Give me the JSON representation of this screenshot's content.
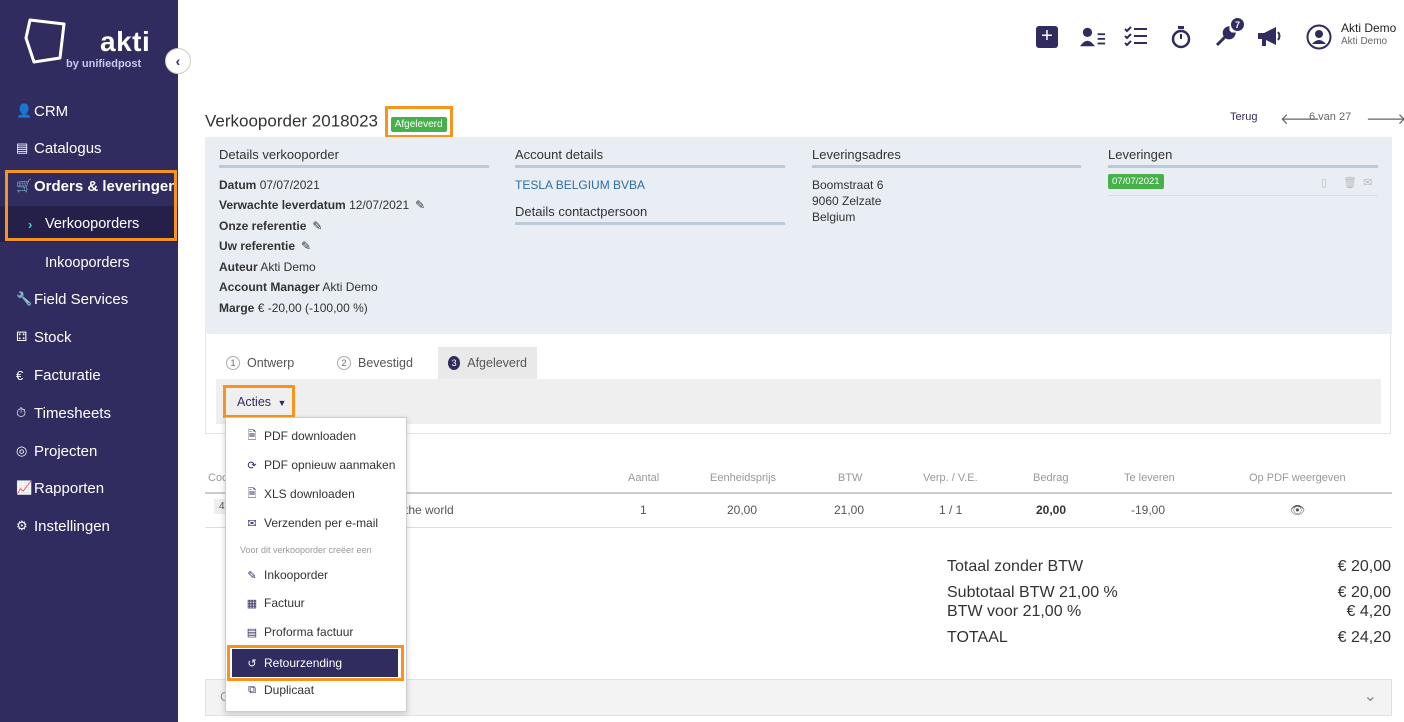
{
  "brand": {
    "name": "akti",
    "tagline": "by unifiedpost"
  },
  "sidebar": {
    "items": [
      {
        "label": "CRM",
        "icon": "user-icon"
      },
      {
        "label": "Catalogus",
        "icon": "book-icon"
      },
      {
        "label": "Orders & leveringen",
        "icon": "cart-icon"
      },
      {
        "label": "Verkooporders",
        "icon": "chevron-right-icon"
      },
      {
        "label": "Inkooporders"
      },
      {
        "label": "Field Services",
        "icon": "wrench-icon"
      },
      {
        "label": "Stock",
        "icon": "cubes-icon"
      },
      {
        "label": "Facturatie",
        "icon": "euro-icon"
      },
      {
        "label": "Timesheets",
        "icon": "stopwatch-icon"
      },
      {
        "label": "Projecten",
        "icon": "target-icon"
      },
      {
        "label": "Rapporten",
        "icon": "chart-icon"
      },
      {
        "label": "Instellingen",
        "icon": "gear-icon"
      }
    ]
  },
  "topbar": {
    "badge_count": "7",
    "user_name": "Akti Demo",
    "user_sub": "Akti Demo"
  },
  "header": {
    "title": "Verkooporder 2018023",
    "status": "Afgeleverd",
    "back": "Terug",
    "pager": "6 van 27"
  },
  "details": {
    "title": "Details verkooporder",
    "rows": [
      {
        "label": "Datum",
        "value": "07/07/2021"
      },
      {
        "label": "Verwachte leverdatum",
        "value": "12/07/2021"
      },
      {
        "label": "Onze referentie",
        "value": ""
      },
      {
        "label": "Uw referentie",
        "value": ""
      },
      {
        "label": "Auteur",
        "value": "Akti Demo"
      },
      {
        "label": "Account Manager",
        "value": "Akti Demo"
      },
      {
        "label": "Marge",
        "value": "€ -20,00 (-100,00 %)"
      }
    ]
  },
  "account": {
    "title": "Account details",
    "company": "TESLA BELGIUM BVBA",
    "contact_title": "Details contactpersoon"
  },
  "delivery_address": {
    "title": "Leveringsadres",
    "line1": "Boomstraat 6",
    "line2": "9060 Zelzate",
    "line3": "Belgium"
  },
  "deliveries": {
    "title": "Leveringen",
    "date": "07/07/2021"
  },
  "tabs": [
    {
      "num": "1",
      "label": "Ontwerp"
    },
    {
      "num": "2",
      "label": "Bevestigd"
    },
    {
      "num": "3",
      "label": "Afgeleverd"
    }
  ],
  "actions": {
    "button": "Acties",
    "menu": [
      {
        "label": "PDF downloaden",
        "icon": "pdf-icon"
      },
      {
        "label": "PDF opnieuw aanmaken",
        "icon": "refresh-icon"
      },
      {
        "label": "XLS downloaden",
        "icon": "xls-icon"
      },
      {
        "label": "Verzenden per e-mail",
        "icon": "envelope-icon"
      }
    ],
    "section_label": "Voor dit verkooporder creëer een",
    "create_menu": [
      {
        "label": "Inkooporder",
        "icon": "pen-icon"
      },
      {
        "label": "Factuur",
        "icon": "invoice-icon"
      },
      {
        "label": "Proforma factuur",
        "icon": "proforma-icon"
      },
      {
        "label": "Retourzending",
        "icon": "undo-icon"
      },
      {
        "label": "Duplicaat",
        "icon": "copy-icon"
      }
    ]
  },
  "table": {
    "headers": {
      "code": "Coc",
      "aantal": "Aantal",
      "eenheidsprijs": "Eenheidsprijs",
      "btw": "BTW",
      "verp": "Verp. / V.E.",
      "bedrag": "Bedrag",
      "te_leveren": "Te leveren",
      "op_pdf": "Op PDF weergeven"
    },
    "row": {
      "code": "4",
      "description": "the world",
      "aantal": "1",
      "eenheidsprijs": "20,00",
      "btw": "21,00",
      "verp": "1 / 1",
      "bedrag": "20,00",
      "te_leveren": "-19,00"
    }
  },
  "totals": {
    "excl_label": "Totaal zonder BTW",
    "excl_value": "€ 20,00",
    "sub_label": "Subtotaal  BTW 21,00 %",
    "sub_value": "€ 20,00",
    "btw_label": "BTW voor 21,00 %",
    "btw_value": "€ 4,20",
    "total_label": "TOTAAL",
    "total_value": "€ 24,20"
  },
  "bottom": {
    "label": "C"
  },
  "colors": {
    "brand": "#302c60",
    "highlight": "#f7941d",
    "success": "#46b04a"
  }
}
